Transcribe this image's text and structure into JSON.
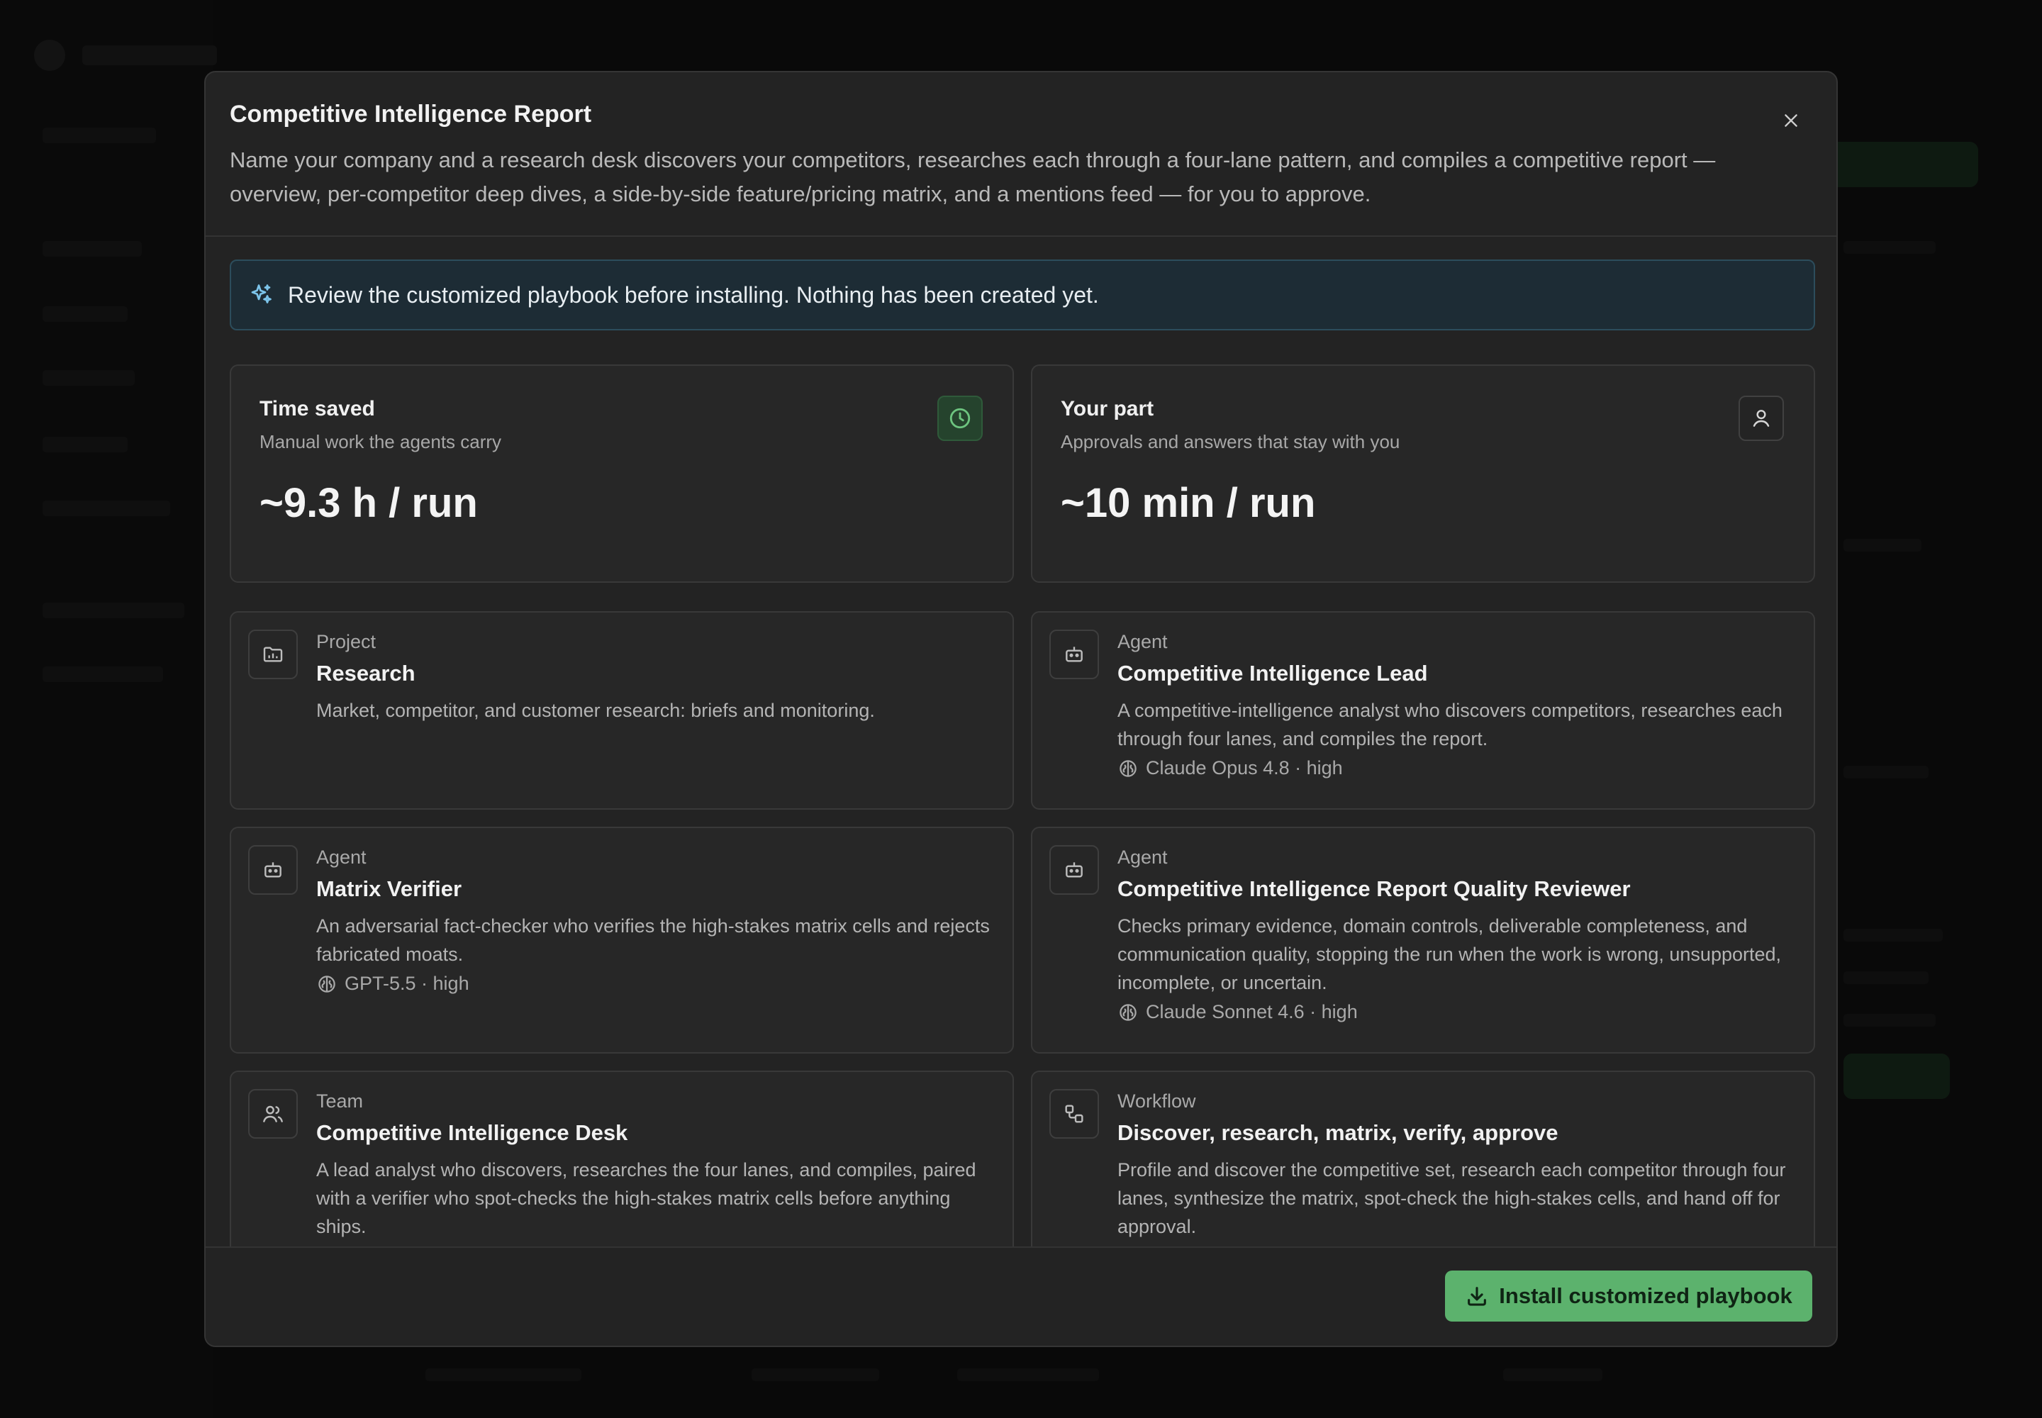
{
  "modal": {
    "title": "Competitive Intelligence Report",
    "description": "Name your company and a research desk discovers your competitors, researches each through a four-lane pattern, and compiles a competitive report — overview, per-competitor deep dives, a side-by-side feature/pricing matrix, and a mentions feed — for you to approve.",
    "close_icon": "close-icon"
  },
  "notice": {
    "icon": "sparkle-icon",
    "text": "Review the customized playbook before installing. Nothing has been created yet."
  },
  "stats": [
    {
      "title": "Time saved",
      "subtitle": "Manual work the agents carry",
      "value": "~9.3 h / run",
      "icon": "clock-icon"
    },
    {
      "title": "Your part",
      "subtitle": "Approvals and answers that stay with you",
      "value": "~10 min / run",
      "icon": "user-icon"
    }
  ],
  "items": [
    {
      "kind": "Project",
      "name": "Research",
      "description": "Market, competitor, and customer research: briefs and monitoring.",
      "icon": "folder-icon"
    },
    {
      "kind": "Agent",
      "name": "Competitive Intelligence Lead",
      "description": "A competitive-intelligence analyst who discovers competitors, researches each through four lanes, and compiles the report.",
      "model": "Claude Opus 4.8 · high",
      "icon": "robot-icon"
    },
    {
      "kind": "Agent",
      "name": "Matrix Verifier",
      "description": "An adversarial fact-checker who verifies the high-stakes matrix cells and rejects fabricated moats.",
      "model": "GPT-5.5 · high",
      "icon": "robot-icon"
    },
    {
      "kind": "Agent",
      "name": "Competitive Intelligence Report Quality Reviewer",
      "description": "Checks primary evidence, domain controls, deliverable completeness, and communication quality, stopping the run when the work is wrong, unsupported, incomplete, or uncertain.",
      "model": "Claude Sonnet 4.6 · high",
      "icon": "robot-icon"
    },
    {
      "kind": "Team",
      "name": "Competitive Intelligence Desk",
      "description": "A lead analyst who discovers, researches the four lanes, and compiles, paired with a verifier who spot-checks the high-stakes matrix cells before anything ships.",
      "icon": "users-icon"
    },
    {
      "kind": "Workflow",
      "name": "Discover, research, matrix, verify, approve",
      "description": "Profile and discover the competitive set, research each competitor through four lanes, synthesize the matrix, spot-check the high-stakes cells, and hand off for approval.",
      "icon": "workflow-icon"
    }
  ],
  "footer": {
    "install_label": "Install customized playbook",
    "install_icon": "download-icon"
  },
  "colors": {
    "accent": "#5cb26d",
    "notice_bg": "#1d2c35",
    "modal_bg": "#232323"
  }
}
